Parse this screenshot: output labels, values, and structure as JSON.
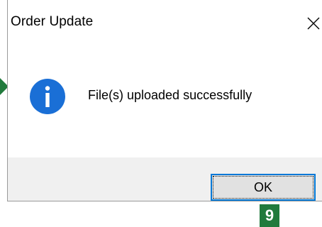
{
  "dialog": {
    "title": "Order Update",
    "close_icon": "close-icon",
    "message": "File(s) uploaded successfully",
    "info_icon": "info-icon",
    "ok_label": "OK"
  },
  "annotation": {
    "step_number": "9",
    "badge_color": "#217a3c",
    "arrow_color": "#217a3c"
  },
  "colors": {
    "accent": "#0078d7",
    "footer_bg": "#f0f0f0",
    "button_bg": "#e1e1e1"
  }
}
